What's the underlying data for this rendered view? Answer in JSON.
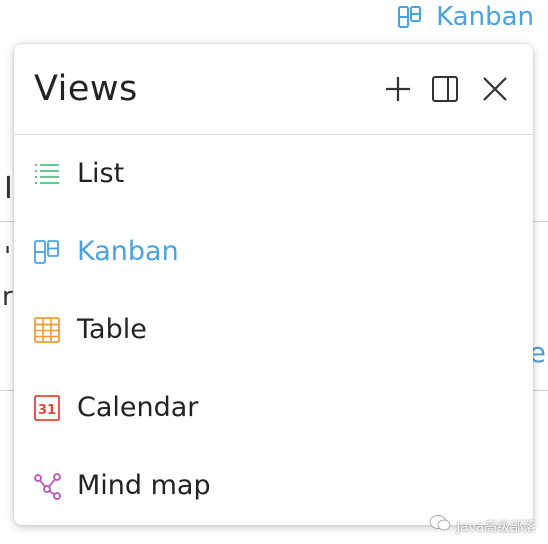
{
  "current_view": {
    "label": "Kanban",
    "icon": "kanban-icon"
  },
  "panel": {
    "title": "Views",
    "actions": [
      {
        "name": "add-view",
        "icon": "plus-icon"
      },
      {
        "name": "toggle-sidebar",
        "icon": "sidebar-icon"
      },
      {
        "name": "close",
        "icon": "close-icon"
      }
    ],
    "items": [
      {
        "label": "List",
        "icon": "list-icon",
        "color": "#3bb273",
        "active": false
      },
      {
        "label": "Kanban",
        "icon": "kanban-icon",
        "color": "#4aa3df",
        "active": true
      },
      {
        "label": "Table",
        "icon": "table-icon",
        "color": "#f39c35",
        "active": false
      },
      {
        "label": "Calendar",
        "icon": "calendar-icon",
        "color": "#e0443a",
        "active": false,
        "icon_text": "31"
      },
      {
        "label": "Mind map",
        "icon": "mind-map-icon",
        "color": "#b84fb8",
        "active": false
      }
    ]
  },
  "watermark": {
    "text": "Java高级部落"
  },
  "colors": {
    "accent": "#4aa3df",
    "divider": "#dcdcdc"
  }
}
